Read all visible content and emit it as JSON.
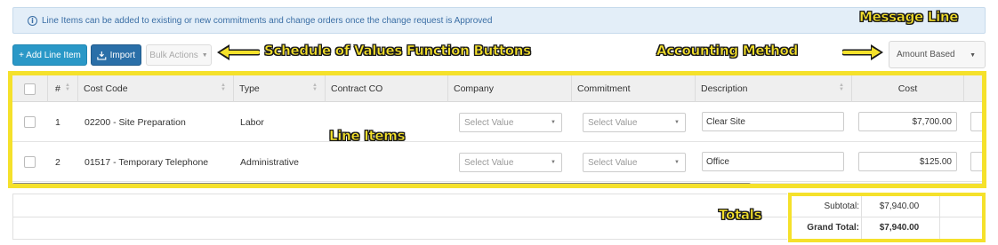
{
  "banner": {
    "icon": "info-icon",
    "text": "Line Items can be added to existing or new commitments and change orders once the change request is Approved"
  },
  "toolbar": {
    "add_label": "+ Add Line Item",
    "import_label": "Import",
    "bulk_label": "Bulk Actions"
  },
  "accounting": {
    "selected": "Amount Based"
  },
  "callouts": {
    "message_line": "Message Line",
    "sov_buttons": "Schedule of Values Function Buttons",
    "accounting_method": "Accounting Method",
    "line_items": "Line Items",
    "totals": "Totals"
  },
  "table": {
    "headers": {
      "num": "#",
      "cost_code": "Cost Code",
      "type": "Type",
      "contract_co": "Contract CO",
      "company": "Company",
      "commitment": "Commitment",
      "description": "Description",
      "cost": "Cost"
    },
    "select_placeholder": "Select Value",
    "rows": [
      {
        "num": "1",
        "cost_code": "02200 - Site Preparation",
        "type": "Labor",
        "contract_co": "",
        "description": "Clear Site",
        "cost": "$7,700.00"
      },
      {
        "num": "2",
        "cost_code": "01517 - Temporary Telephone",
        "type": "Administrative",
        "contract_co": "",
        "description": "Office",
        "cost": "$125.00"
      }
    ]
  },
  "totals": {
    "subtotal_label": "Subtotal:",
    "subtotal_value": "$7,940.00",
    "grand_total_label": "Grand Total:",
    "grand_total_value": "$7,940.00"
  },
  "colors": {
    "callout": "#f5e12b",
    "primary": "#2a98c7",
    "banner_bg": "#e3eef8"
  }
}
